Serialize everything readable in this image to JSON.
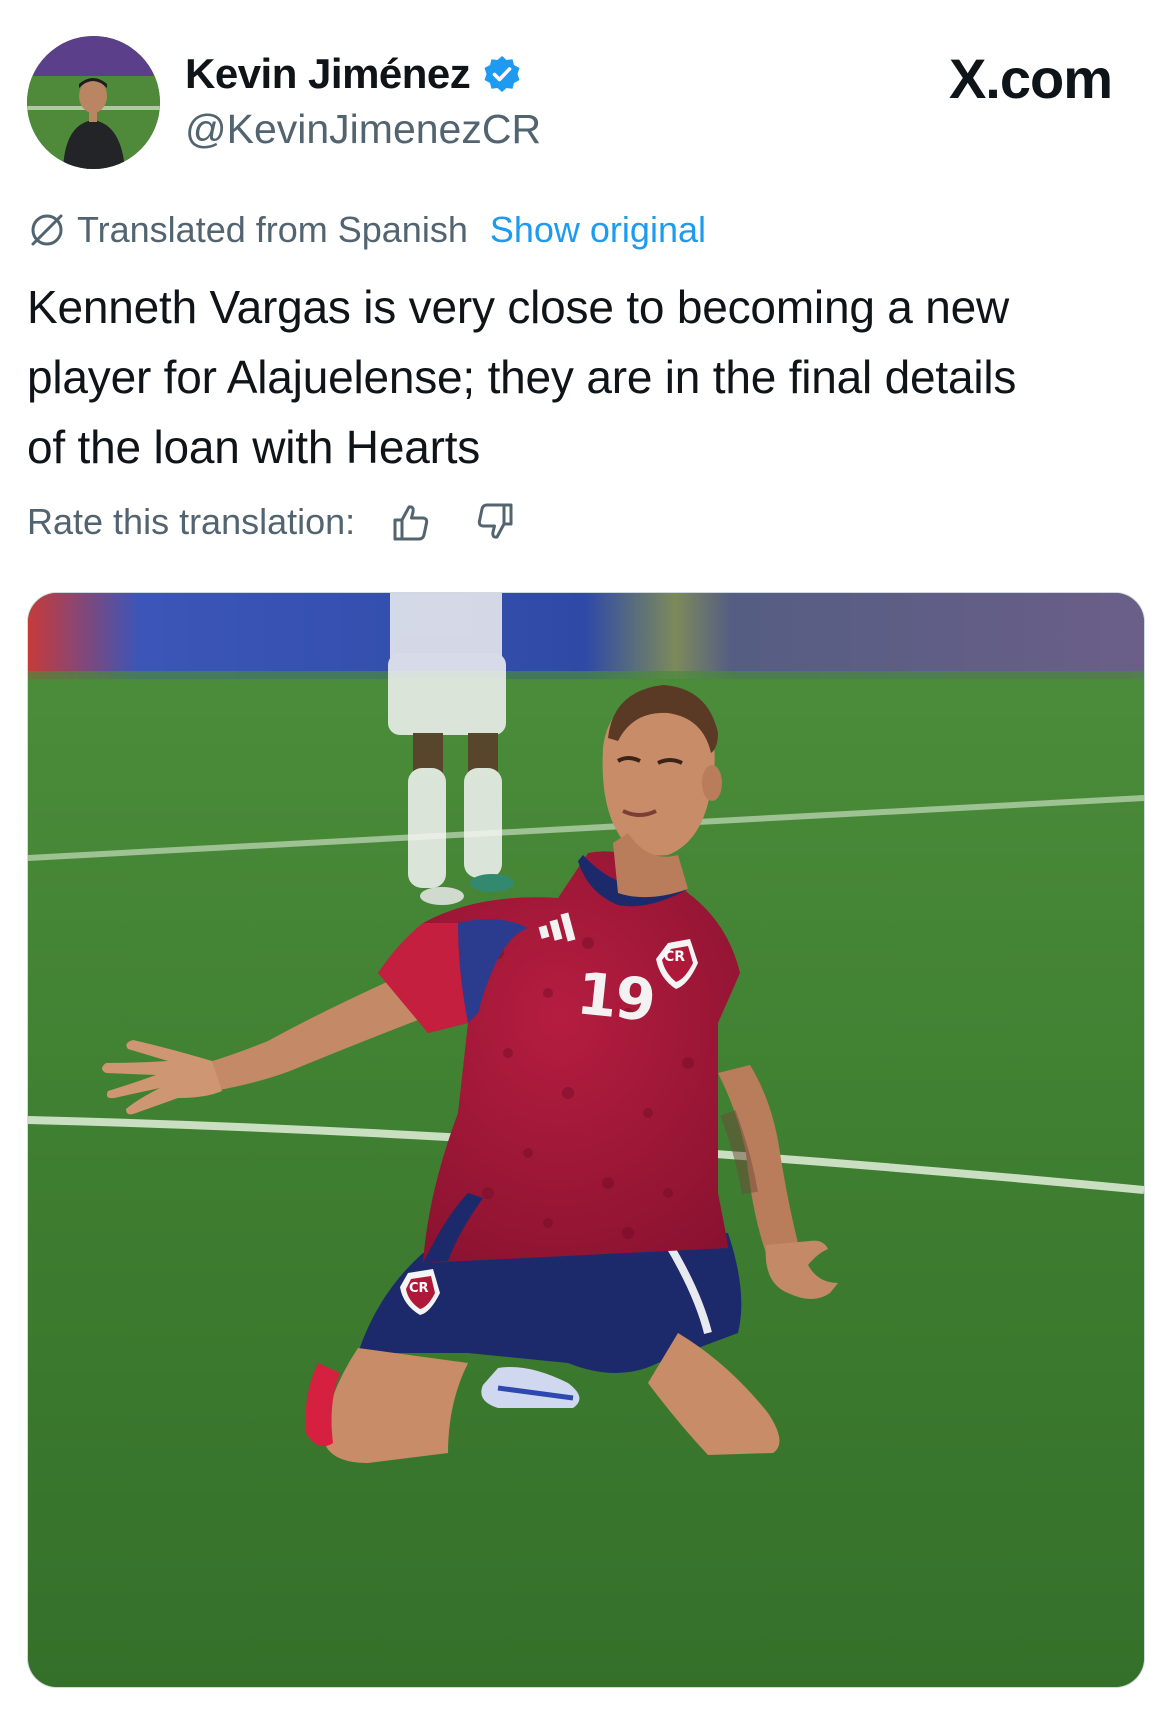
{
  "tweet": {
    "author": {
      "display_name": "Kevin Jiménez",
      "handle": "@KevinJimenezCR",
      "verified": true
    },
    "site_label": "X.com",
    "translation": {
      "notice": "Translated from Spanish",
      "show_original": "Show original",
      "rate_label": "Rate this translation:"
    },
    "text_lines": [
      "Kenneth Vargas is very close to becoming a new",
      "player for Alajuelense; they are in the final details",
      "of the loan with Hearts"
    ],
    "media": {
      "jersey_number": "19",
      "crest_text": "CR"
    }
  },
  "colors": {
    "link_blue": "#1d9bf0",
    "verified_blue": "#1d9bf0",
    "secondary_text": "#536471",
    "primary_text": "#0f1419",
    "pitch_green": "#3f7d33",
    "jersey_red": "#b0183a",
    "shorts_navy": "#1c2a6b"
  },
  "icons": {
    "verified": "verified-badge-icon",
    "translate": "globe-slash-icon",
    "thumbs_up": "thumbs-up-icon",
    "thumbs_down": "thumbs-down-icon"
  }
}
